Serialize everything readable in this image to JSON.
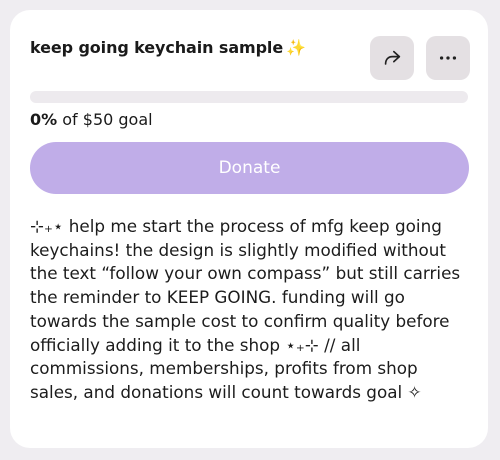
{
  "campaign": {
    "title": "keep going keychain sample",
    "title_emoji": "✨",
    "goal_percent_text": "0%",
    "goal_rest_text": "of $50 goal",
    "progress_fraction": 0,
    "donate_label": "Donate",
    "description": "⊹₊⋆ help me start the process of mfg keep going keychains! the design is slightly modified without the text “follow your own compass” but still carries the reminder to KEEP GOING. funding will go towards the sample cost to confirm quality before officially adding it to the shop ⋆₊⊹ // all commissions, memberships, profits from shop sales, and donations will count towards goal ✧"
  },
  "icons": {
    "share": "share-arrow-icon",
    "more": "more-horizontal-icon"
  },
  "colors": {
    "card_bg": "#ffffff",
    "page_bg": "#efedf1",
    "icon_button_bg": "#e4e0e3",
    "progress_track": "#edeaee",
    "donate_button": "#c0ade8",
    "donate_text": "#ffffff"
  }
}
